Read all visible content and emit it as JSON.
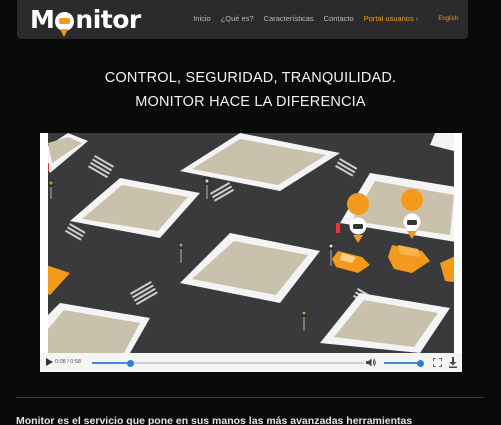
{
  "brand": {
    "name_left": "M",
    "name_right": "nitor"
  },
  "nav": {
    "items": [
      "Inicio",
      "¿Qué es?",
      "Características",
      "Contacto"
    ],
    "portal": "Portal usuarios ›",
    "language": "English"
  },
  "headline": {
    "line1": "CONTROL, SEGURIDAD, TRANQUILIDAD.",
    "line2": "MONITOR HACE LA DIFERENCIA"
  },
  "video": {
    "time": "0:08 / 0:58",
    "progress": 0.14,
    "volume": 0.95
  },
  "body_text": "Monitor es el servicio que pone en sus manos las más avanzadas herramientas",
  "colors": {
    "accent": "#f39a1d",
    "navbar": "#2b2b2b",
    "seek": "#2f7fd4"
  },
  "icons": [
    "play-icon",
    "volume-icon",
    "fullscreen-icon",
    "download-icon",
    "car-pin-icon"
  ]
}
